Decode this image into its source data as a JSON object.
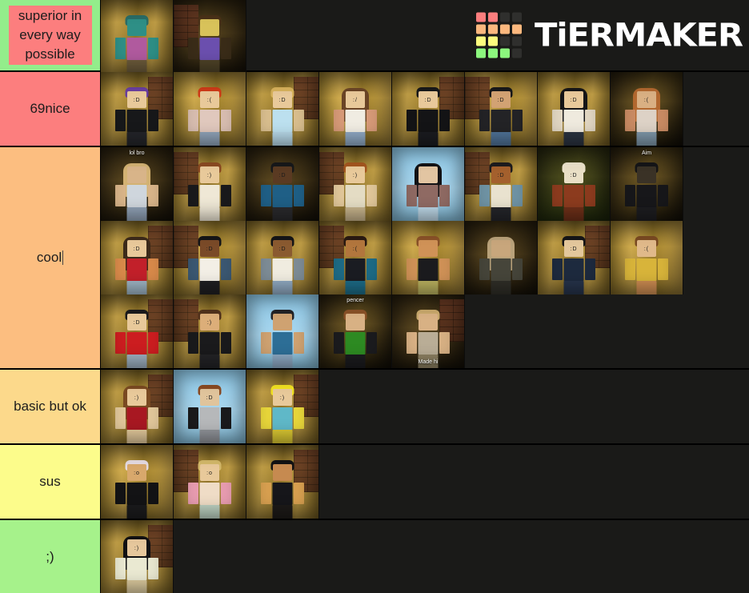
{
  "app": {
    "name": "TierMaker",
    "logo_word": "TiERMAKER",
    "background_color": "#1a1a18",
    "logo_grid_colors": [
      "#fc7e7e",
      "#fc7e7e",
      "#2f2f2d",
      "#2f2f2d",
      "#fcb87e",
      "#fcb87e",
      "#fcb87e",
      "#fcb87e",
      "#fcfc7e",
      "#fcfc7e",
      "#2f2f2d",
      "#2f2f2d",
      "#8cf77e",
      "#8cf77e",
      "#8cf77e",
      "#2f2f2d"
    ]
  },
  "tiers": [
    {
      "id": "tier-s",
      "label": "superior in every way possible",
      "color": "#93ed8b",
      "label_highlighted": true,
      "highlight_color": "#fc7e7e",
      "rows": 1,
      "item_count": 2,
      "items": [
        {
          "name": "fish-head-avatar",
          "bg": "bg-wood",
          "brick": false,
          "skin": "#2e8f86",
          "hair": "#2a6d67",
          "hair_style": "short",
          "shirt": "#b05a9e",
          "arms": "#2e8f86",
          "legs": "#6b5a3a",
          "face": "",
          "note": ""
        },
        {
          "name": "cowboy-hat-avatar",
          "bg": "bg-dark",
          "brick": true,
          "skin": "#d8c25a",
          "hair": "#4a3118",
          "hair_style": "hat",
          "shirt": "#6b4fae",
          "arms": "#3a2c18",
          "legs": "#4e4227",
          "face": "",
          "note": ""
        }
      ]
    },
    {
      "id": "tier-a",
      "label": "69nice",
      "color": "#fc7e7e",
      "label_highlighted": false,
      "rows": 1,
      "item_count": 8,
      "items": [
        {
          "name": "rainbow-hair-avatar",
          "bg": "bg-wood",
          "brick": true,
          "skin": "#e8c99a",
          "hair": "#6a3fa0",
          "hair_style": "short",
          "shirt": "#17181a",
          "arms": "#17181a",
          "legs": "#24252a",
          "face": ":D",
          "note": ""
        },
        {
          "name": "red-buns-avatar",
          "bg": "bg-wood2",
          "brick": false,
          "skin": "#e8c99a",
          "hair": "#cf3b18",
          "hair_style": "short",
          "shirt": "#e0c8bd",
          "arms": "#d8bdb0",
          "legs": "#8fa3b8",
          "face": ":(",
          "note": ""
        },
        {
          "name": "blonde-blue-shirt-avatar",
          "bg": "bg-wood",
          "brick": true,
          "skin": "#e8c99a",
          "hair": "#d8b25c",
          "hair_style": "short",
          "shirt": "#bce0ef",
          "arms": "#d9be8e",
          "legs": "#b7d8e8",
          "face": ":D",
          "note": ""
        },
        {
          "name": "brown-hair-crop-avatar",
          "bg": "bg-wood2",
          "brick": false,
          "skin": "#e8c99a",
          "hair": "#6b4526",
          "hair_style": "long",
          "shirt": "#f0ece2",
          "arms": "#d79a78",
          "legs": "#8fa9c4",
          "face": ":/",
          "note": ""
        },
        {
          "name": "black-jacket-avatar",
          "bg": "bg-wood",
          "brick": true,
          "skin": "#e8c99a",
          "hair": "#17181a",
          "hair_style": "short",
          "shirt": "#141416",
          "arms": "#141416",
          "legs": "#1b1c20",
          "face": ":D",
          "note": ""
        },
        {
          "name": "dark-shirt-jeans-avatar",
          "bg": "bg-wood2",
          "brick": true,
          "skin": "#d2a273",
          "hair": "#17181a",
          "hair_style": "short",
          "shirt": "#232326",
          "arms": "#232326",
          "legs": "#4f7296",
          "face": ":D",
          "note": ""
        },
        {
          "name": "black-bob-skirt-avatar",
          "bg": "bg-wood",
          "brick": false,
          "skin": "#e8c99a",
          "hair": "#151517",
          "hair_style": "long",
          "shirt": "#efeade",
          "arms": "#e1d6c2",
          "legs": "#2b3340",
          "face": ":D",
          "note": ""
        },
        {
          "name": "ginger-side-avatar",
          "bg": "bg-hall",
          "brick": false,
          "skin": "#d9b083",
          "hair": "#b2682f",
          "hair_style": "long",
          "shirt": "#ddd2c6",
          "arms": "#c98b63",
          "legs": "#7e96a8",
          "face": ":(",
          "note": ""
        }
      ]
    },
    {
      "id": "tier-b",
      "label": "cool",
      "color": "#fcbe80",
      "label_highlighted": false,
      "caret": true,
      "rows": 3,
      "item_count": 21,
      "items": [
        {
          "name": "lol-bro-overlay-avatar",
          "bg": "bg-dark",
          "brick": false,
          "skin": "#d8b489",
          "hair": "#d3b273",
          "hair_style": "long",
          "shirt": "#cfd6dd",
          "arms": "#d8b489",
          "legs": "#8fa0b4",
          "face": "",
          "note": "lol bro"
        },
        {
          "name": "glasses-suspenders-avatar",
          "bg": "bg-wood",
          "brick": true,
          "skin": "#e8c99a",
          "hair": "#8b4a22",
          "hair_style": "short",
          "shirt": "#efe8d6",
          "arms": "#1a1a1c",
          "legs": "#efe8d6",
          "face": ":)",
          "note": ""
        },
        {
          "name": "blue-floral-shirt-avatar",
          "bg": "bg-dark",
          "brick": false,
          "skin": "#5a3a22",
          "hair": "#17181a",
          "hair_style": "short",
          "shirt": "#1f5f86",
          "arms": "#1f5f86",
          "legs": "#2a2a2c",
          "face": ":D",
          "note": ""
        },
        {
          "name": "cream-tee-avatar",
          "bg": "bg-wood",
          "brick": true,
          "skin": "#e8c99a",
          "hair": "#a4561f",
          "hair_style": "short",
          "shirt": "#e4dcc4",
          "arms": "#e1c79a",
          "legs": "#c7b38c",
          "face": ":)",
          "note": ""
        },
        {
          "name": "long-black-hair-sky-avatar",
          "bg": "bg-sky",
          "brick": false,
          "skin": "#e2c5a2",
          "hair": "#131316",
          "hair_style": "long",
          "shirt": "#8f6a63",
          "arms": "#8f6a63",
          "legs": "#bcd6e6",
          "face": "",
          "note": ""
        },
        {
          "name": "denim-jacket-avatar",
          "bg": "bg-wood",
          "brick": true,
          "skin": "#a4602d",
          "hair": "#1d1c1e",
          "hair_style": "short",
          "shirt": "#e9e2cf",
          "arms": "#6f93a4",
          "legs": "#24252a",
          "face": ":D",
          "note": ""
        },
        {
          "name": "white-hood-patterned-avatar",
          "bg": "bg-grass",
          "brick": false,
          "skin": "#e9dfc6",
          "hair": "#ece3cb",
          "hair_style": "hat",
          "shirt": "#8c3b1e",
          "arms": "#8c3b1e",
          "legs": "#6d2f18",
          "face": ":D",
          "note": ""
        },
        {
          "name": "dark-hallway-avatar",
          "bg": "bg-hall",
          "brick": false,
          "skin": "#3a3226",
          "hair": "#151517",
          "hair_style": "short",
          "shirt": "#17171a",
          "arms": "#17171a",
          "legs": "#1d1d20",
          "face": "",
          "note": "Aim"
        },
        {
          "name": "red-striped-overalls-avatar",
          "bg": "bg-wood",
          "brick": true,
          "skin": "#e8c99a",
          "hair": "#3c2a1a",
          "hair_style": "long",
          "shirt": "#c2202a",
          "arms": "#d98a4a",
          "legs": "#9db4c4",
          "face": ":D",
          "note": ""
        },
        {
          "name": "white-shirt-denim-avatar",
          "bg": "bg-wood2",
          "brick": true,
          "skin": "#7a4a28",
          "hair": "#151517",
          "hair_style": "short",
          "shirt": "#f3efe6",
          "arms": "#3b5872",
          "legs": "#1f1f22",
          "face": ":D",
          "note": ""
        },
        {
          "name": "mouse-ears-avatar",
          "bg": "bg-wood",
          "brick": false,
          "skin": "#8a5a30",
          "hair": "#151517",
          "hair_style": "short",
          "shirt": "#f0ece0",
          "arms": "#7d8c96",
          "legs": "#8fa8c0",
          "face": ":D",
          "note": ""
        },
        {
          "name": "teal-jacket-avatar",
          "bg": "bg-wood",
          "brick": true,
          "skin": "#b2763d",
          "hair": "#2a1a12",
          "hair_style": "short",
          "shirt": "#1a1c22",
          "arms": "#1d6b86",
          "legs": "#1d6b86",
          "face": ":(",
          "note": ""
        },
        {
          "name": "updo-brown-hair-avatar",
          "bg": "bg-wood2",
          "brick": false,
          "skin": "#d09257",
          "hair": "#8a5228",
          "hair_style": "short",
          "shirt": "#1b1b1e",
          "arms": "#d09257",
          "legs": "#b8b05e",
          "face": "",
          "note": ""
        },
        {
          "name": "blurry-dress-avatar",
          "bg": "bg-dark",
          "brick": false,
          "skin": "#c8a67c",
          "hair": "#b9a27a",
          "hair_style": "long",
          "shirt": "#46453a",
          "arms": "#46453a",
          "legs": "#2f2e27",
          "face": "",
          "note": ""
        },
        {
          "name": "navy-jacket-avatar",
          "bg": "bg-wood",
          "brick": true,
          "skin": "#e3c79c",
          "hair": "#151517",
          "hair_style": "short",
          "shirt": "#1d2a3e",
          "arms": "#1d2a3e",
          "legs": "#26334a",
          "face": ":D",
          "note": ""
        },
        {
          "name": "yellow-plaid-avatar",
          "bg": "bg-wood2",
          "brick": false,
          "skin": "#e0b98a",
          "hair": "#7a4a22",
          "hair_style": "short",
          "shirt": "#d8b43a",
          "arms": "#d8b43a",
          "legs": "#c98a50",
          "face": ":(",
          "note": ""
        },
        {
          "name": "red-pattern-sweater-avatar",
          "bg": "bg-wood",
          "brick": true,
          "skin": "#e8c99a",
          "hair": "#1a1a1c",
          "hair_style": "short",
          "shirt": "#cc1d20",
          "arms": "#cc1d20",
          "legs": "#9db0c0",
          "face": ":D",
          "note": ""
        },
        {
          "name": "black-jacket-brick-avatar",
          "bg": "bg-wood",
          "brick": true,
          "skin": "#dcae79",
          "hair": "#52321c",
          "hair_style": "short",
          "shirt": "#1a1a1c",
          "arms": "#1a1a1c",
          "legs": "#232326",
          "face": ":)",
          "note": ""
        },
        {
          "name": "blue-floral-sky-avatar",
          "bg": "bg-sky",
          "brick": false,
          "skin": "#cfa271",
          "hair": "#232326",
          "hair_style": "short",
          "shirt": "#2d6e96",
          "arms": "#cfa271",
          "legs": "#8ca8c2",
          "face": "",
          "note": ""
        },
        {
          "name": "green-shirt-hall-avatar",
          "bg": "bg-hall",
          "brick": false,
          "skin": "#d8b184",
          "hair": "#8a5228",
          "hair_style": "short",
          "shirt": "#2d8a22",
          "arms": "#1b1b1e",
          "legs": "#1b1b1e",
          "face": "",
          "note": "pencer"
        },
        {
          "name": "made-hi-overlay-avatar",
          "bg": "bg-dark",
          "brick": true,
          "skin": "#d8b184",
          "hair": "#c9a96c",
          "hair_style": "short",
          "shirt": "#b9ad96",
          "arms": "#d8b184",
          "legs": "#8d8062",
          "face": "",
          "note": "Made hi"
        }
      ]
    },
    {
      "id": "tier-c",
      "label": "basic but ok",
      "color": "#fcd98b",
      "label_highlighted": false,
      "rows": 1,
      "item_count": 3,
      "items": [
        {
          "name": "red-top-ponytail-avatar",
          "bg": "bg-wood",
          "brick": true,
          "skin": "#e8c99a",
          "hair": "#7a4a22",
          "hair_style": "long",
          "shirt": "#a81822",
          "arms": "#e1c79a",
          "legs": "#e1c79a",
          "face": ":)",
          "note": ""
        },
        {
          "name": "grey-apron-glasses-avatar",
          "bg": "bg-sky",
          "brick": false,
          "skin": "#e0c49c",
          "hair": "#8a4a22",
          "hair_style": "short",
          "shirt": "#b6b8ba",
          "arms": "#1a1a1c",
          "legs": "#8f9298",
          "face": ":D",
          "note": ""
        },
        {
          "name": "yellow-spiky-hair-avatar",
          "bg": "bg-wood",
          "brick": true,
          "skin": "#e8c99a",
          "hair": "#f2e222",
          "hair_style": "short",
          "shirt": "#5fb8c8",
          "arms": "#e8d63a",
          "legs": "#d8c632",
          "face": ":)",
          "note": ""
        }
      ]
    },
    {
      "id": "tier-d",
      "label": "sus",
      "color": "#fcfc8b",
      "label_highlighted": false,
      "rows": 1,
      "item_count": 3,
      "items": [
        {
          "name": "white-hair-black-hoodie-avatar",
          "bg": "bg-wood2",
          "brick": false,
          "skin": "#d8a86c",
          "hair": "#e6dce4",
          "hair_style": "short",
          "shirt": "#131315",
          "arms": "#131315",
          "legs": "#1b1b1d",
          "face": ":o",
          "note": ""
        },
        {
          "name": "pink-jacket-blonde-avatar",
          "bg": "bg-wood",
          "brick": true,
          "skin": "#e8c99a",
          "hair": "#d4b96a",
          "hair_style": "short",
          "shirt": "#efdcc6",
          "arms": "#e89cb0",
          "legs": "#bcd0c0",
          "face": ":o",
          "note": ""
        },
        {
          "name": "black-hair-dark-dress-avatar",
          "bg": "bg-wood",
          "brick": true,
          "skin": "#c68a50",
          "hair": "#121214",
          "hair_style": "short",
          "shirt": "#16161a",
          "arms": "#d8a050",
          "legs": "#1d1a18",
          "face": "",
          "note": ""
        }
      ]
    },
    {
      "id": "tier-e",
      "label": ";)",
      "color": "#a6f28b",
      "label_highlighted": false,
      "rows": 1,
      "item_count": 1,
      "items": [
        {
          "name": "long-black-hair-white-dress-avatar",
          "bg": "bg-wood",
          "brick": true,
          "skin": "#e6c79c",
          "hair": "#111113",
          "hair_style": "long",
          "shirt": "#eae9d2",
          "arms": "#e8e7d0",
          "legs": "#d8c79c",
          "face": ":)",
          "note": ""
        }
      ]
    }
  ]
}
